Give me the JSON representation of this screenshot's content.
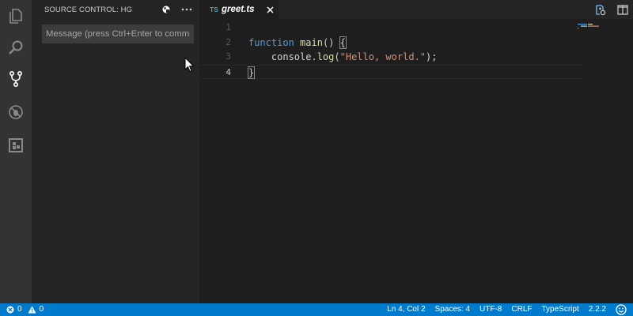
{
  "activity_bar": {
    "items": [
      {
        "name": "explorer",
        "icon": "files-icon"
      },
      {
        "name": "search",
        "icon": "search-icon"
      },
      {
        "name": "source-control",
        "icon": "source-control-icon",
        "active": true
      },
      {
        "name": "debug",
        "icon": "debug-icon"
      },
      {
        "name": "extensions",
        "icon": "extensions-icon"
      }
    ]
  },
  "sidebar": {
    "title": "SOURCE CONTROL: HG",
    "actions": [
      "switch-provider-icon",
      "more-icon"
    ],
    "commit_placeholder": "Message (press Ctrl+Enter to commit)",
    "commit_value": ""
  },
  "editor": {
    "tab": {
      "lang": "TS",
      "name": "greet.ts",
      "close_icon": "close-icon"
    },
    "actions": [
      "open-changes-icon",
      "split-editor-icon"
    ],
    "lines": [
      {
        "n": "1",
        "segments": []
      },
      {
        "n": "2",
        "segments": [
          [
            "kw",
            "function"
          ],
          [
            "plain",
            " "
          ],
          [
            "fn",
            "main"
          ],
          [
            "plain",
            "() "
          ],
          [
            "br",
            "{"
          ]
        ]
      },
      {
        "n": "3",
        "segments": [
          [
            "plain",
            "    console."
          ],
          [
            "fn",
            "log"
          ],
          [
            "plain",
            "("
          ],
          [
            "str",
            "\"Hello, world.\""
          ],
          [
            "plain",
            ");"
          ]
        ]
      },
      {
        "n": "4",
        "segments": [
          [
            "br",
            "}"
          ]
        ]
      }
    ],
    "current_line": 4
  },
  "status_bar": {
    "errors": "0",
    "warnings": "0",
    "position": "Ln 4, Col 2",
    "spaces": "Spaces: 4",
    "encoding": "UTF-8",
    "eol": "CRLF",
    "language": "TypeScript",
    "version": "2.2.2",
    "feedback_icon": "smiley-icon"
  },
  "colors": {
    "activity_bar": "#333333",
    "sidebar": "#252526",
    "editor": "#1e1e1e",
    "status_bar": "#007acc",
    "keyword": "#569cd6",
    "function": "#dcdcaa",
    "string": "#ce9178",
    "ts_badge": "#519aba"
  }
}
